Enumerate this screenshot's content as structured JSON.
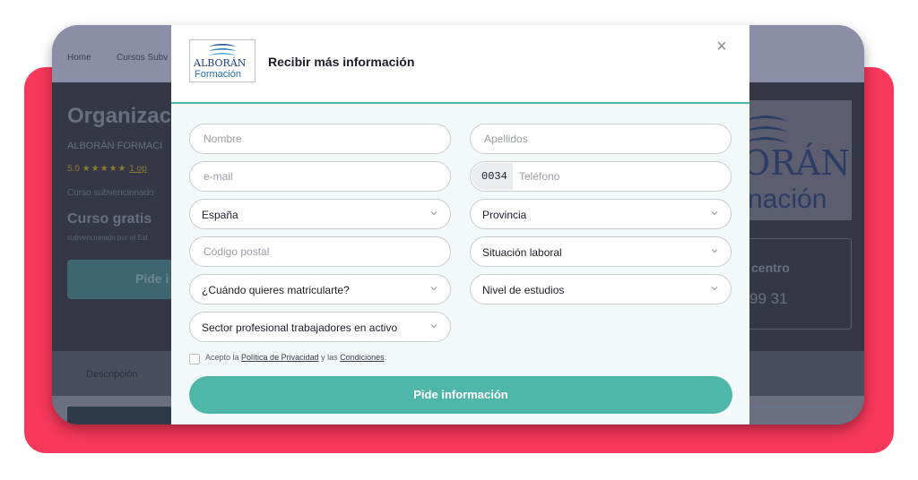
{
  "background": {
    "breadcrumbs": [
      "Home",
      "Cursos Subv"
    ],
    "page_title": "Organizac",
    "provider": "ALBORÁN FORMACI",
    "rating_value": "5.0",
    "rating_stars": "★★★★★",
    "rating_link": "1 op",
    "course_type": "Curso subvencionado",
    "price_label": "Curso gratis",
    "price_note": "subvencionado por el Est",
    "cta_label": "Pide i",
    "logo_text1": "ORÁN",
    "logo_text2": "nación",
    "contact_label": "centro",
    "contact_phone": "99 31",
    "tab_label": "Descripción"
  },
  "modal": {
    "logo_text1": "ALBORÁN",
    "logo_text2": "Formación",
    "title": "Recibir más información",
    "close_symbol": "×",
    "fields": {
      "nombre_placeholder": "Nombre",
      "apellidos_placeholder": "Apellidos",
      "email_placeholder": "e-mail",
      "phone_prefix": "0034",
      "phone_placeholder": "Teléfono",
      "country_value": "España",
      "province_value": "Provincia",
      "postal_placeholder": "Código postal",
      "employment_value": "Situación laboral",
      "enroll_value": "¿Cuándo quieres matricularte?",
      "education_value": "Nivel de estudios",
      "sector_value": "Sector profesional trabajadores en activo"
    },
    "consent": {
      "prefix": "Acepto la",
      "privacy_link": "Política de Privacidad",
      "middle": "y las",
      "conditions_link": "Condiciones",
      "suffix": "."
    },
    "submit_label": "Pide información"
  },
  "colors": {
    "accent": "#4fb7a9",
    "frame": "#f7385a",
    "logo_blue": "#1c3f8c"
  }
}
